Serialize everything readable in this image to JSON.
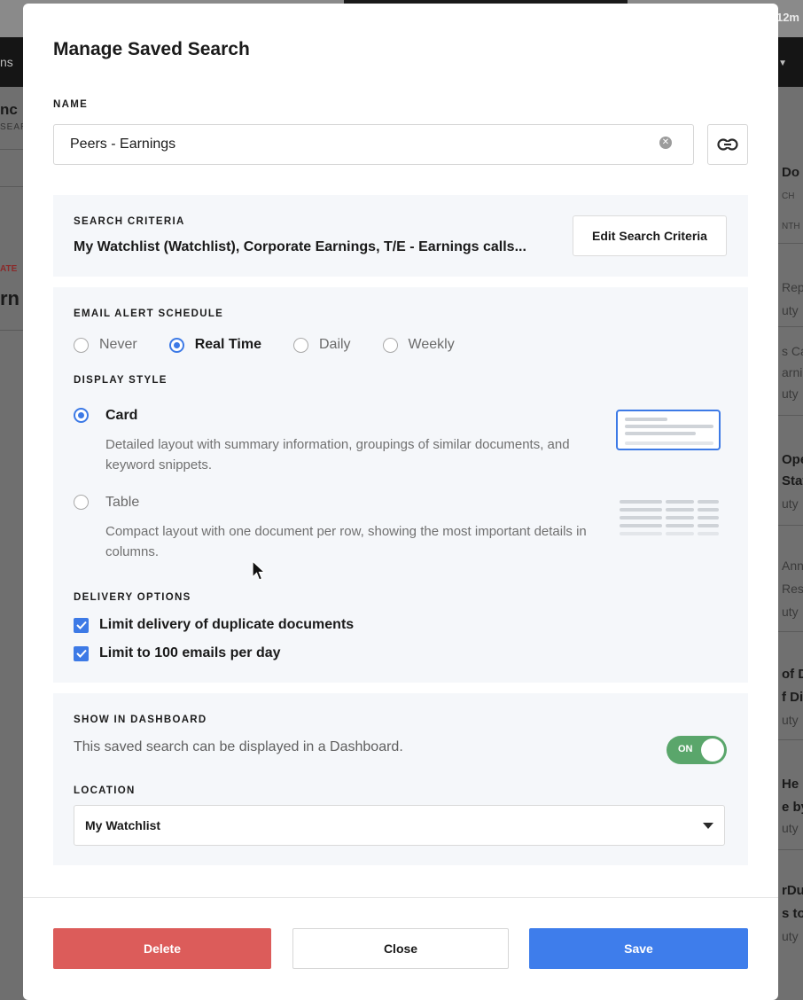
{
  "background": {
    "top_right_text": "12m",
    "nav_left_text": "ns",
    "left_fragments": [
      "nc",
      "SEAR",
      "ATE",
      "rn"
    ],
    "right_fragments": [
      "Do",
      "CH",
      "NTH",
      "Repo",
      "uty",
      "s Ca",
      "arni",
      "uty",
      "Ope",
      "State",
      "uty",
      "Ann",
      "Resu",
      "uty",
      "of D",
      "f Dir",
      "uty",
      "He",
      "e by",
      "uty",
      "rDu",
      "s to",
      "uty"
    ]
  },
  "modal": {
    "title": "Manage Saved Search",
    "name": {
      "label": "NAME",
      "value": "Peers - Earnings"
    },
    "criteria": {
      "label": "SEARCH CRITERIA",
      "text": "My Watchlist (Watchlist), Corporate Earnings, T/E - Earnings calls...",
      "edit_button": "Edit Search Criteria"
    },
    "email_schedule": {
      "label": "EMAIL ALERT SCHEDULE",
      "options": [
        "Never",
        "Real Time",
        "Daily",
        "Weekly"
      ],
      "selected": "Real Time"
    },
    "display_style": {
      "label": "DISPLAY STYLE",
      "options": [
        {
          "title": "Card",
          "description": "Detailed layout with summary information, groupings of similar documents, and keyword snippets.",
          "selected": true
        },
        {
          "title": "Table",
          "description": "Compact layout with one document per row, showing the most important details in columns.",
          "selected": false
        }
      ]
    },
    "delivery": {
      "label": "DELIVERY OPTIONS",
      "options": [
        {
          "label": "Limit delivery of duplicate documents",
          "checked": true
        },
        {
          "label": "Limit to 100 emails per day",
          "checked": true
        }
      ]
    },
    "dashboard": {
      "label": "SHOW IN DASHBOARD",
      "description": "This saved search can be displayed in a Dashboard.",
      "toggle_text": "ON",
      "toggle_on": true,
      "location_label": "LOCATION",
      "location_value": "My Watchlist"
    },
    "buttons": {
      "delete": "Delete",
      "close": "Close",
      "save": "Save"
    }
  },
  "colors": {
    "accent": "#3d7ae6",
    "delete": "#dc5c5a",
    "save": "#3e7deb",
    "toggle_on": "#5aa66b",
    "panel_bg": "#f5f7fa"
  }
}
